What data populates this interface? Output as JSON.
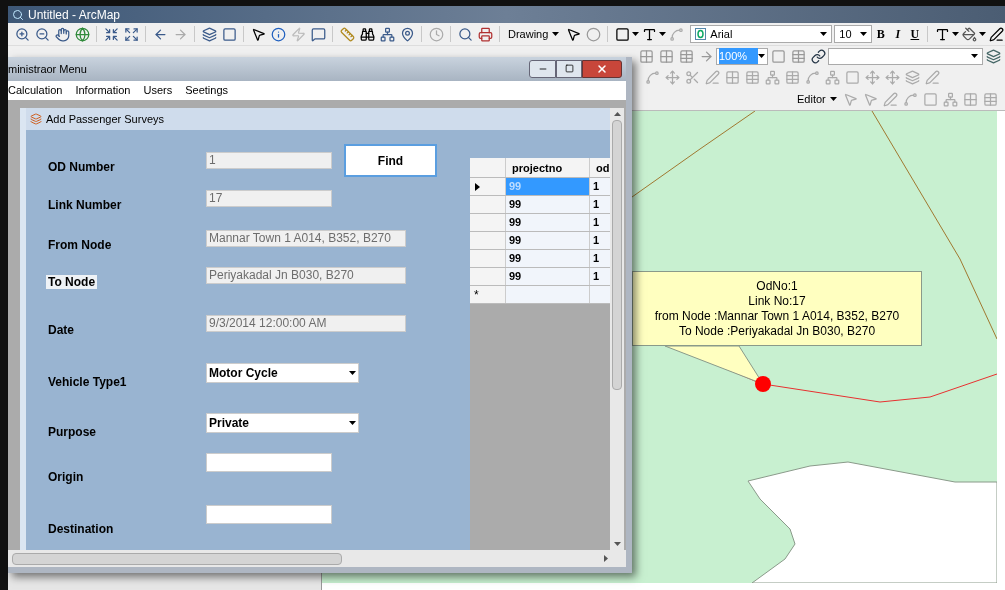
{
  "window": {
    "title": "Untitled - ArcMap"
  },
  "toolbar": {
    "drawing_menu": "Drawing",
    "font": "Arial",
    "font_size": "10",
    "bold": "B",
    "italic": "I",
    "underline": "U",
    "zoom": "100%",
    "editor_menu": "Editor"
  },
  "admin_window": {
    "title": "ministraor Menu",
    "menu": [
      "Calculation",
      "Information",
      "Users",
      "Seetings"
    ]
  },
  "survey_form": {
    "title": "Add Passenger Surveys",
    "find_button": "Find",
    "fields": [
      {
        "label": "OD Number",
        "kind": "readonly",
        "value": "1",
        "focused": false
      },
      {
        "label": "Link Number",
        "kind": "readonly",
        "value": "17",
        "focused": false
      },
      {
        "label": "From Node",
        "kind": "readonly",
        "value": "Mannar Town 1 A014, B352, B270",
        "focused": false
      },
      {
        "label": "To Node",
        "kind": "readonly",
        "value": "Periyakadal Jn B030, B270",
        "focused": true
      },
      {
        "label": "Date",
        "kind": "readonly",
        "value": "9/3/2014 12:00:00 AM",
        "focused": false
      },
      {
        "label": "Vehicle Type1",
        "kind": "select",
        "value": "Motor Cycle",
        "focused": false
      },
      {
        "label": "Purpose",
        "kind": "select",
        "value": "Private",
        "focused": false
      },
      {
        "label": "Origin",
        "kind": "input",
        "focused": false
      },
      {
        "label": "Destination",
        "kind": "input",
        "focused": false
      }
    ]
  },
  "grid": {
    "columns": [
      "projectno",
      "od"
    ],
    "new_row_marker": "*",
    "rows": [
      {
        "cells": [
          "99",
          "1"
        ],
        "selected": true
      },
      {
        "cells": [
          "99",
          "1"
        ],
        "selected": false
      },
      {
        "cells": [
          "99",
          "1"
        ],
        "selected": false
      },
      {
        "cells": [
          "99",
          "1"
        ],
        "selected": false
      },
      {
        "cells": [
          "99",
          "1"
        ],
        "selected": false
      },
      {
        "cells": [
          "99",
          "1"
        ],
        "selected": false
      }
    ]
  },
  "map": {
    "callout": [
      "OdNo:1",
      "Link No:17",
      "from Node :Mannar Town 1 A014, B352, B270",
      "To Node :Periyakadal Jn B030, B270"
    ]
  }
}
